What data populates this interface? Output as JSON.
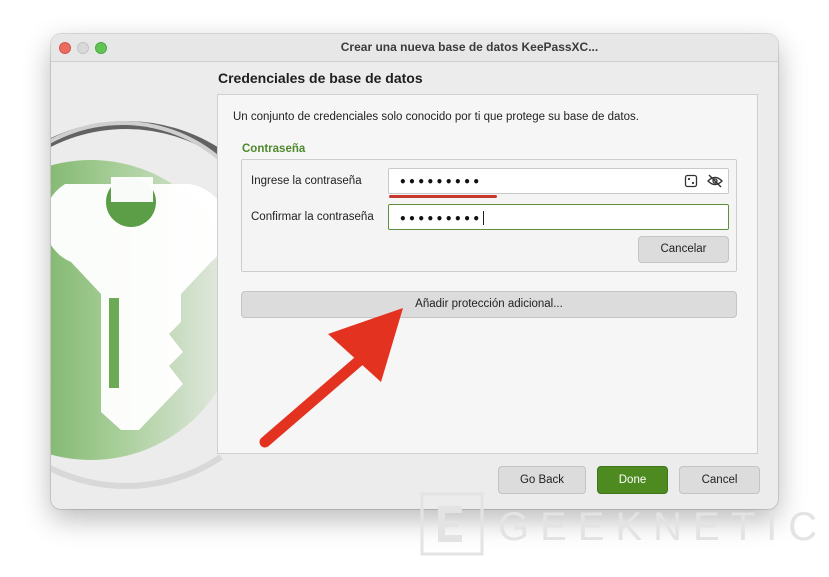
{
  "window": {
    "title": "Crear una nueva base de datos KeePassXC..."
  },
  "section": {
    "title": "Credenciales de base de datos"
  },
  "panel": {
    "description": "Un conjunto de credenciales solo conocido por ti que protege su base de datos.",
    "password_group": {
      "label": "Contraseña",
      "enter_label": "Ingrese la contraseña",
      "enter_value": "•••••••••",
      "confirm_label": "Confirmar la contraseña",
      "confirm_value": "•••••••••",
      "cancel_label": "Cancelar"
    },
    "add_protection_label": "Añadir protección adicional..."
  },
  "footer": {
    "go_back": "Go Back",
    "done": "Done",
    "cancel": "Cancel"
  },
  "watermark": {
    "text": "GEEKNETIC"
  },
  "icons": {
    "dice": "dice-icon",
    "visibility": "eye-slash-icon",
    "arrow": "red-arrow-annotation"
  },
  "colors": {
    "accent_green": "#4d8a1f",
    "label_green": "#4d8a2c",
    "strength_red": "#c8372d",
    "arrow_red": "#e3321f"
  }
}
